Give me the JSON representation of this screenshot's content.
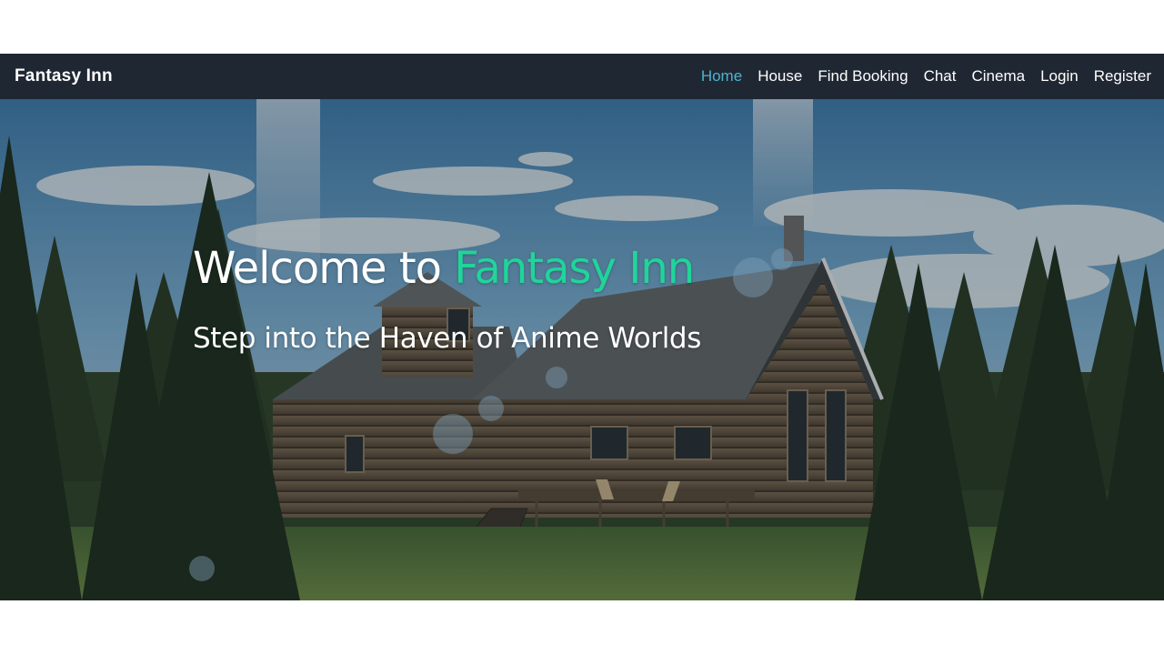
{
  "navbar": {
    "brand": "Fantasy Inn",
    "links": [
      {
        "label": "Home",
        "active": true
      },
      {
        "label": "House",
        "active": false
      },
      {
        "label": "Find Booking",
        "active": false
      },
      {
        "label": "Chat",
        "active": false
      },
      {
        "label": "Cinema",
        "active": false
      },
      {
        "label": "Login",
        "active": false
      },
      {
        "label": "Register",
        "active": false
      }
    ]
  },
  "hero": {
    "title_prefix": "Welcome to ",
    "title_accent": "Fantasy Inn",
    "subtitle": "Step into the Haven of Anime Worlds",
    "background_image": "log-cabin-forest-illustration"
  },
  "colors": {
    "navbar_bg": "#1f2732",
    "nav_active": "#4fb3cf",
    "accent": "#1fd59a",
    "text": "#ffffff"
  }
}
